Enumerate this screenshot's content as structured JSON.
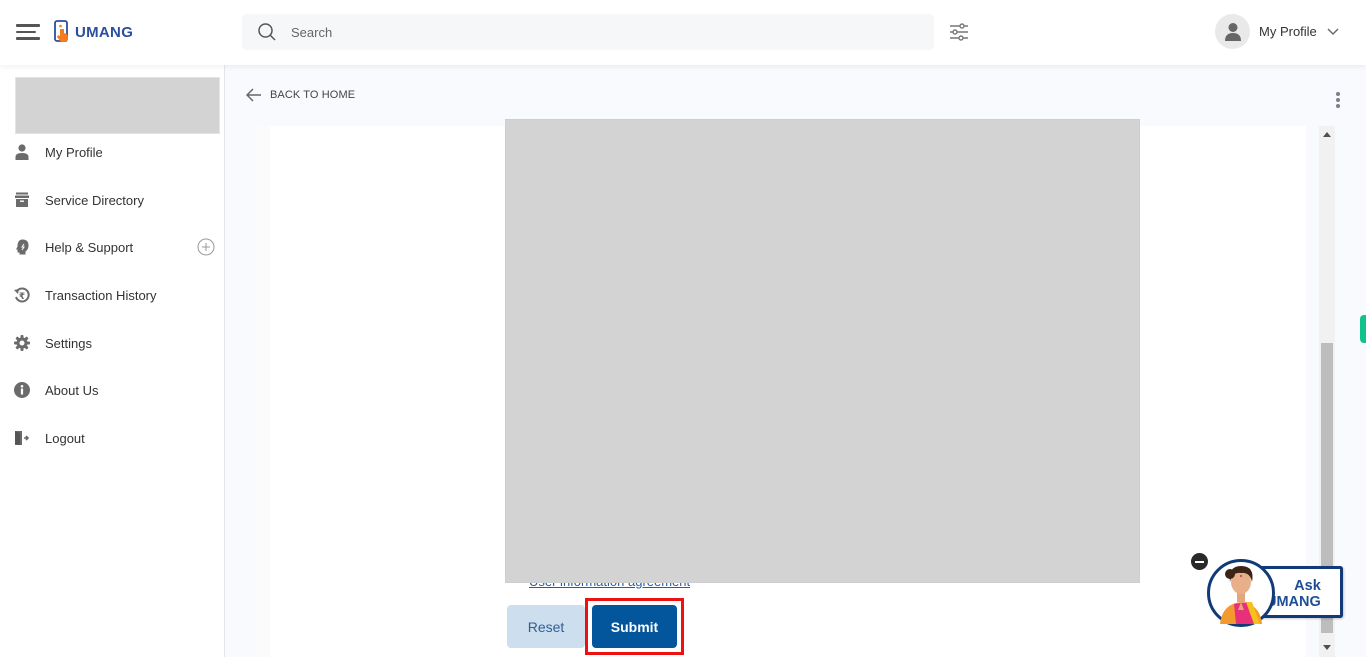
{
  "header": {
    "logo_text": "UMANG",
    "search_placeholder": "Search",
    "search_value": "",
    "profile_label": "My Profile"
  },
  "sidebar": {
    "items": [
      {
        "label": "My Profile",
        "icon": "user-icon"
      },
      {
        "label": "Service Directory",
        "icon": "archive-icon"
      },
      {
        "label": "Help & Support",
        "icon": "headset-icon",
        "expandable": true
      },
      {
        "label": "Transaction History",
        "icon": "rupee-history-icon"
      },
      {
        "label": "Settings",
        "icon": "gear-icon"
      },
      {
        "label": "About Us",
        "icon": "info-icon"
      },
      {
        "label": "Logout",
        "icon": "logout-icon"
      }
    ]
  },
  "main": {
    "back_label": "BACK TO HOME",
    "agreement_link": "User information agreement",
    "reset_label": "Reset",
    "submit_label": "Submit"
  },
  "ask_umang": {
    "line1": "Ask",
    "line2": "UMANG"
  },
  "colors": {
    "brand_blue": "#2b4fa0",
    "submit_blue": "#03559c",
    "reset_bg": "#cddfee",
    "highlight_red": "#ee1111",
    "accent_green": "#12c28c"
  }
}
